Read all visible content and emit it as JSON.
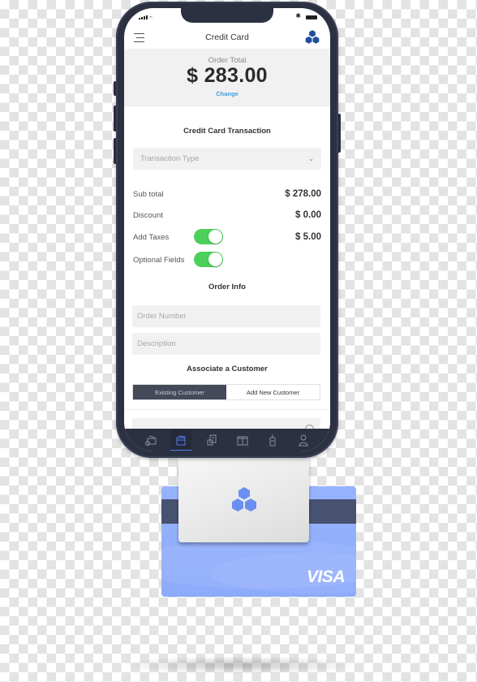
{
  "status_bar": {
    "signal_icon": "cellular-signal-icon",
    "wifi_icon": "wifi-icon",
    "bluetooth_icon": "bluetooth-icon",
    "battery_icon": "battery-icon"
  },
  "header": {
    "title": "Credit Card",
    "menu_icon": "hamburger-menu-icon",
    "brand_icon": "cubes-logo-icon",
    "brand_color": "#1f4e9c"
  },
  "order_total": {
    "label": "Order Total",
    "amount": "$ 283.00",
    "change_link": "Change",
    "link_color": "#3aa0e0"
  },
  "transaction": {
    "section_title": "Credit Card Transaction",
    "type_select": {
      "placeholder": "Transaction Type",
      "icon": "chevron-down-icon"
    },
    "rows": [
      {
        "label": "Sub total",
        "value": "$ 278.00"
      },
      {
        "label": "Discount",
        "value": "$ 0.00"
      },
      {
        "label": "Add Taxes",
        "value": "$ 5.00",
        "toggle": true
      },
      {
        "label": "Optional Fields",
        "value": "",
        "toggle": true
      }
    ],
    "toggle_color": "#4cd05c"
  },
  "order_info": {
    "section_title": "Order Info",
    "order_number_placeholder": "Order Number",
    "description_placeholder": "Description"
  },
  "customer": {
    "section_title": "Associate a Customer",
    "segments": [
      {
        "label": "Existing Customer",
        "active": true
      },
      {
        "label": "Add New Customer",
        "active": false
      }
    ],
    "search_icon": "search-icon"
  },
  "tab_bar": {
    "tabs": [
      {
        "name": "register",
        "icon": "register-icon",
        "active": false
      },
      {
        "name": "credit-card",
        "icon": "card-terminal-icon",
        "active": true
      },
      {
        "name": "receipts",
        "icon": "receipt-icon",
        "active": false
      },
      {
        "name": "products",
        "icon": "gift-box-icon",
        "active": false
      },
      {
        "name": "inventory",
        "icon": "tag-icon",
        "active": false
      },
      {
        "name": "customers",
        "icon": "user-icon",
        "active": false
      }
    ],
    "active_color": "#4f7ff0"
  },
  "card_reader": {
    "logo_icon": "cubes-logo-icon",
    "logo_color": "#6b8ff0"
  },
  "credit_card": {
    "brand": "VISA",
    "card_color": "#93b0fd",
    "stripe_color": "#475270"
  }
}
